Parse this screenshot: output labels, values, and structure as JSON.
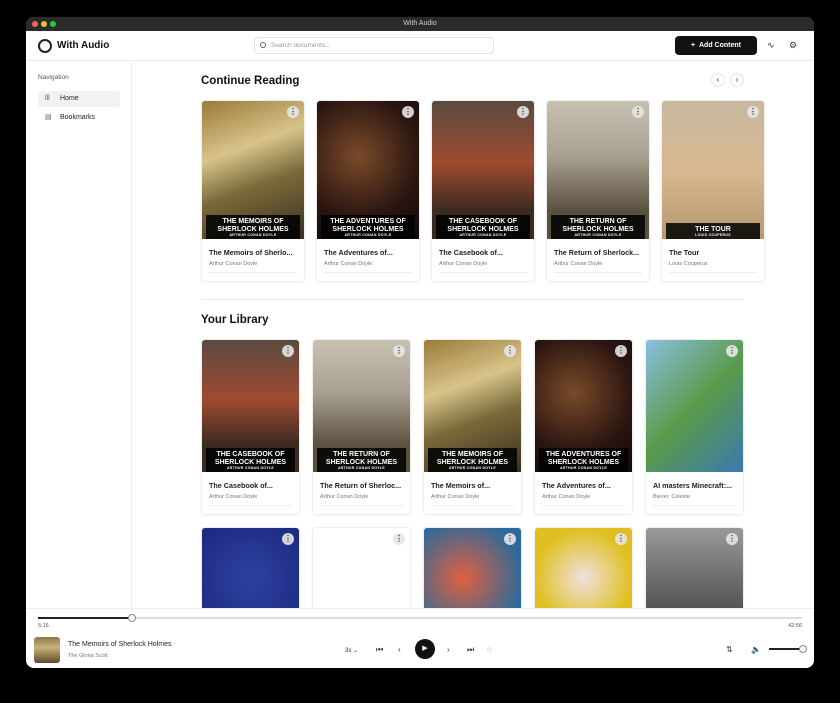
{
  "window": {
    "title": "With Audio"
  },
  "header": {
    "brand": "With Audio",
    "search_placeholder": "Search documents...",
    "add_label": "Add Content",
    "add_icon": "+"
  },
  "sidebar": {
    "label": "Navigation",
    "items": [
      {
        "label": "Home",
        "icon": "library-icon"
      },
      {
        "label": "Bookmarks",
        "icon": "bookmark-icon"
      }
    ]
  },
  "continue": {
    "title": "Continue Reading",
    "items": [
      {
        "title": "The Memoirs of Sherlo...",
        "author": "Arthur Conan Doyle",
        "cover_title": "THE MEMOIRS OF SHERLOCK HOLMES",
        "cover_author": "ARTHUR CONAN DOYLE",
        "bg": "linear-gradient(160deg,#9a7a3a,#d8c48a 35%,#7a6a3a 60%,#3a3020)"
      },
      {
        "title": "The Adventures of...",
        "author": "Arthur Conan Doyle",
        "cover_title": "THE ADVENTURES OF SHERLOCK HOLMES",
        "cover_author": "ARTHUR CONAN DOYLE",
        "bg": "radial-gradient(circle at 40% 40%,#7a4a2a,#2a1510 60%,#120a08)"
      },
      {
        "title": "The Casebook of...",
        "author": "Arthur Conan Doyle",
        "cover_title": "THE CASEBOOK OF SHERLOCK HOLMES",
        "cover_author": "ARTHUR CONAN DOYLE",
        "bg": "linear-gradient(#5a4a40,#a04a30 45%,#3a2a20 80%)"
      },
      {
        "title": "The Return of Sherlock...",
        "author": "Arthur Conan Doyle",
        "cover_title": "THE RETURN OF SHERLOCK HOLMES",
        "cover_author": "ARTHUR CONAN DOYLE",
        "bg": "linear-gradient(#c8c0b0,#a8a090 40%,#5a5040 80%)"
      },
      {
        "title": "The Tour",
        "author": "Louis Couperus",
        "cover_title": "THE TOUR",
        "cover_author": "LOUIS COUPERUS",
        "bg": "linear-gradient(#c8b8a0,#d8b890 50%,#b89870)"
      }
    ]
  },
  "library": {
    "title": "Your Library",
    "items": [
      {
        "title": "The Casebook of...",
        "author": "Arthur Conan Doyle",
        "cover_title": "THE CASEBOOK OF SHERLOCK HOLMES",
        "cover_author": "ARTHUR CONAN DOYLE",
        "bg": "linear-gradient(#5a4a40,#a04a30 45%,#3a2a20 80%)"
      },
      {
        "title": "The Return of Sherloc...",
        "author": "Arthur Conan Doyle",
        "cover_title": "THE RETURN OF SHERLOCK HOLMES",
        "cover_author": "ARTHUR CONAN DOYLE",
        "bg": "linear-gradient(#c8c0b0,#a8a090 40%,#5a5040 80%)"
      },
      {
        "title": "The Memoirs of...",
        "author": "Arthur Conan Doyle",
        "cover_title": "THE MEMOIRS OF SHERLOCK HOLMES",
        "cover_author": "ARTHUR CONAN DOYLE",
        "bg": "linear-gradient(160deg,#9a7a3a,#d8c48a 35%,#7a6a3a 60%,#3a3020)"
      },
      {
        "title": "The Adventures of...",
        "author": "Arthur Conan Doyle",
        "cover_title": "THE ADVENTURES OF SHERLOCK HOLMES",
        "cover_author": "ARTHUR CONAN DOYLE",
        "bg": "radial-gradient(circle at 40% 40%,#7a4a2a,#2a1510 60%,#120a08)"
      },
      {
        "title": "AI masters Minecraft:...",
        "author": "Biever, Celeste",
        "cover_title": "",
        "cover_author": "",
        "bg": "linear-gradient(135deg,#8ac0e0,#5a9a4a 50%,#3a7ab0)"
      }
    ],
    "row2": [
      {
        "bg": "radial-gradient(circle,#3040a0,#1a2a80)"
      },
      {
        "bg": "#fff"
      },
      {
        "bg": "radial-gradient(circle at 40% 50%,#e06040,#2a6a9a 80%)"
      },
      {
        "bg": "radial-gradient(circle,#f0e0e0,#e0c020 70%)"
      },
      {
        "bg": "linear-gradient(#999,#444)"
      }
    ]
  },
  "player": {
    "elapsed": "5:16",
    "duration": "42:56",
    "progress_pct": 12.3,
    "title": "The Memoirs of Sherlock Holmes",
    "chapter": "The Gloria Scott",
    "speed": "3x",
    "volume_pct": 100
  }
}
